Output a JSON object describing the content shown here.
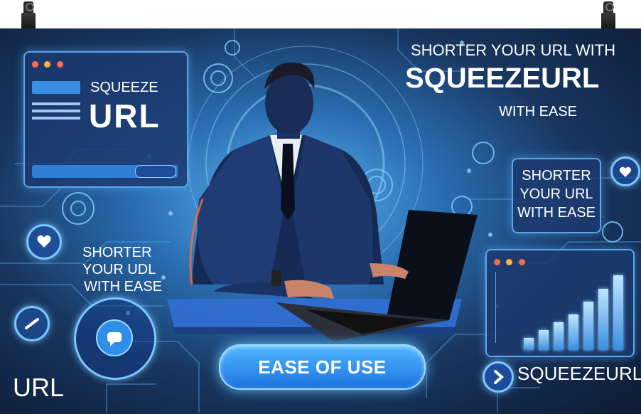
{
  "top_right_heading": {
    "line1": "SHORTER YOUR URL WITH",
    "line2": "SQUEEZEURL",
    "line3": "WITH EASE"
  },
  "top_left_card": {
    "brand_small": "SQUEEZE",
    "brand_large": "URL"
  },
  "right_card": {
    "text": [
      "SHORTER",
      "YOUR URL",
      "WITH EASE"
    ]
  },
  "left_text": {
    "lines": [
      "SHORTER",
      "YOUR UDL",
      "WITH EASE"
    ]
  },
  "bottom_left_label": "URL",
  "bottom_right_label": "SQUEEZEURL",
  "cta_button": "EASE OF USE",
  "chart_bars": [
    0.15,
    0.25,
    0.35,
    0.45,
    0.62,
    0.78,
    0.95
  ],
  "colors": {
    "accent": "#2f8fe8",
    "glow": "#7cc6ff",
    "dark_bg": "#0d1a33"
  }
}
